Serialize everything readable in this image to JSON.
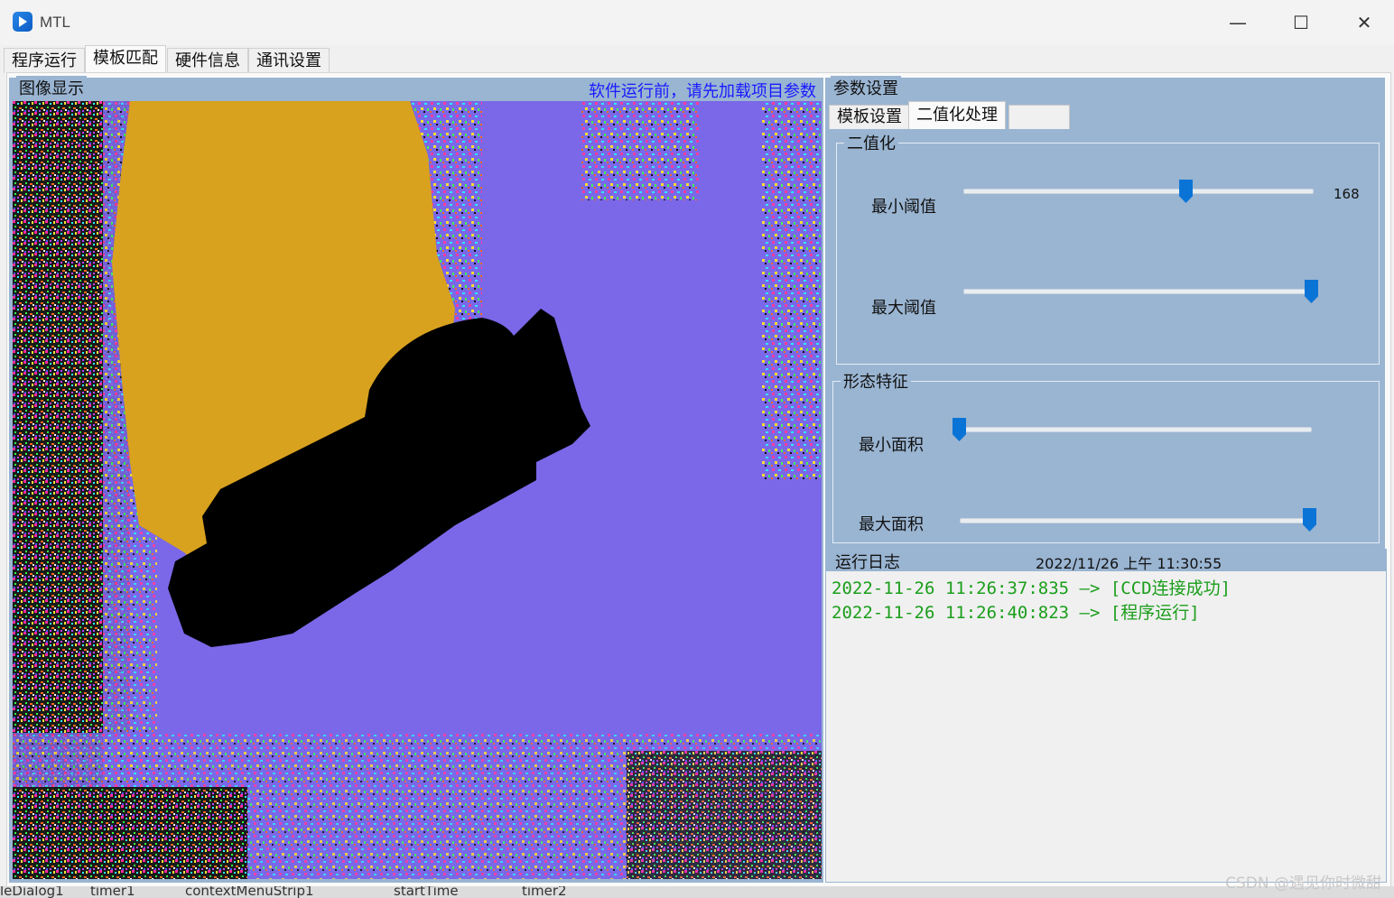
{
  "window": {
    "title": "MTL",
    "minimize": "—",
    "maximize": "☐",
    "close": "✕"
  },
  "main_tabs": [
    "程序运行",
    "模板匹配",
    "硬件信息",
    "通讯设置"
  ],
  "active_main_tab": "模板匹配",
  "image_panel": {
    "title": "图像显示",
    "notice": "软件运行前，请先加载项目参数",
    "notice_color": "#1a1aff",
    "background_color": "#7a68e8",
    "blob_color": "#d8a21e",
    "object_color": "#000000"
  },
  "params": {
    "title": "参数设置",
    "tabs": [
      "模板设置",
      "二值化处理",
      ""
    ],
    "active_tab": "二值化处理",
    "binarize": {
      "title": "二值化",
      "min_label": "最小阈值",
      "min_value": "168",
      "min_fraction": 0.64,
      "max_label": "最大阈值",
      "max_fraction": 1.0
    },
    "morph": {
      "title": "形态特征",
      "min_label": "最小面积",
      "min_fraction": 0.0,
      "max_label": "最大面积",
      "max_fraction": 1.0
    }
  },
  "log": {
    "title": "运行日志",
    "timestamp": "2022/11/26 上午 11:30:55",
    "lines": [
      "2022-11-26 11:26:37:835 —> [CCD连接成功]",
      "2022-11-26 11:26:40:823 —> [程序运行]"
    ],
    "line_color": "#1b9e1b"
  },
  "designer_strip": [
    "leDialog1",
    "timer1",
    "contextMenuStrip1",
    "startTime",
    "timer2"
  ],
  "watermark": "CSDN @遇见你时微甜"
}
